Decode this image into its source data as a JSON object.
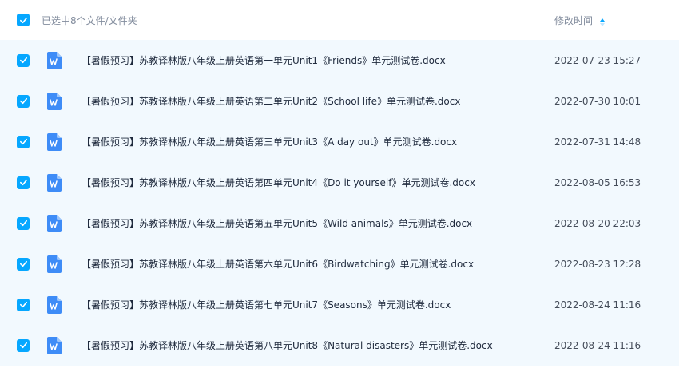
{
  "header": {
    "selection_label": "已选中8个文件/文件夹",
    "modified_label": "修改时间"
  },
  "colors": {
    "accent": "#06a7ff",
    "row_bg": "#f2f9fe",
    "word_icon": "#3e8cf7"
  },
  "icons": {
    "checkbox": "checkbox-checked-icon",
    "file": "word-document-icon",
    "sort": "sort-arrows-icon"
  },
  "files": [
    {
      "name": "【暑假预习】苏教译林版八年级上册英语第一单元Unit1《Friends》单元测试卷.docx",
      "modified": "2022-07-23 15:27"
    },
    {
      "name": "【暑假预习】苏教译林版八年级上册英语第二单元Unit2《School life》单元测试卷.docx",
      "modified": "2022-07-30 10:01"
    },
    {
      "name": "【暑假预习】苏教译林版八年级上册英语第三单元Unit3《A day out》单元测试卷.docx",
      "modified": "2022-07-31 14:48"
    },
    {
      "name": "【暑假预习】苏教译林版八年级上册英语第四单元Unit4《Do it yourself》单元测试卷.docx",
      "modified": "2022-08-05 16:53"
    },
    {
      "name": "【暑假预习】苏教译林版八年级上册英语第五单元Unit5《Wild animals》单元测试卷.docx",
      "modified": "2022-08-20 22:03"
    },
    {
      "name": "【暑假预习】苏教译林版八年级上册英语第六单元Unit6《Birdwatching》单元测试卷.docx",
      "modified": "2022-08-23 12:28"
    },
    {
      "name": "【暑假预习】苏教译林版八年级上册英语第七单元Unit7《Seasons》单元测试卷.docx",
      "modified": "2022-08-24 11:16"
    },
    {
      "name": "【暑假预习】苏教译林版八年级上册英语第八单元Unit8《Natural disasters》单元测试卷.docx",
      "modified": "2022-08-24 11:16"
    }
  ]
}
